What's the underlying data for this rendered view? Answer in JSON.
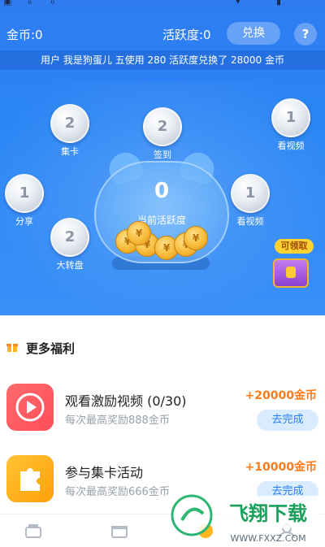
{
  "header": {
    "coin_label": "金币:0",
    "activity_label": "活跃度:0",
    "exchange_button": "兑换",
    "help_button": "?"
  },
  "marquee": "用户 我是狗蛋儿 五使用 280 活跃度兑换了 28000 金币",
  "bubbles": [
    {
      "value": "2",
      "label": "集卡"
    },
    {
      "value": "2",
      "label": "签到"
    },
    {
      "value": "1",
      "label": "看视频"
    },
    {
      "value": "1",
      "label": "分享"
    },
    {
      "value": "1",
      "label": "看视频"
    },
    {
      "value": "2",
      "label": "大转盘"
    }
  ],
  "pot": {
    "value": "0",
    "label": "当前活跃度"
  },
  "chest": {
    "tag": "可领取"
  },
  "section": {
    "title": "更多福利"
  },
  "tasks": [
    {
      "title": "观看激励视频 (0/30)",
      "subtitle": "每次最高奖励888金币",
      "reward": "+20000金币",
      "button": "去完成",
      "color": "#ff5a5a"
    },
    {
      "title": "参与集卡活动",
      "subtitle": "每次最高奖励666金币",
      "reward": "+10000金币",
      "button": "去完成",
      "color": "#ffb51c"
    }
  ],
  "watermark": {
    "brand": "飞翔下载",
    "url": "WWW.FXXZ.COM"
  },
  "colors": {
    "primary": "#2f7cf2",
    "reward": "#ff7a1a",
    "button_bg": "#d9ecff"
  }
}
